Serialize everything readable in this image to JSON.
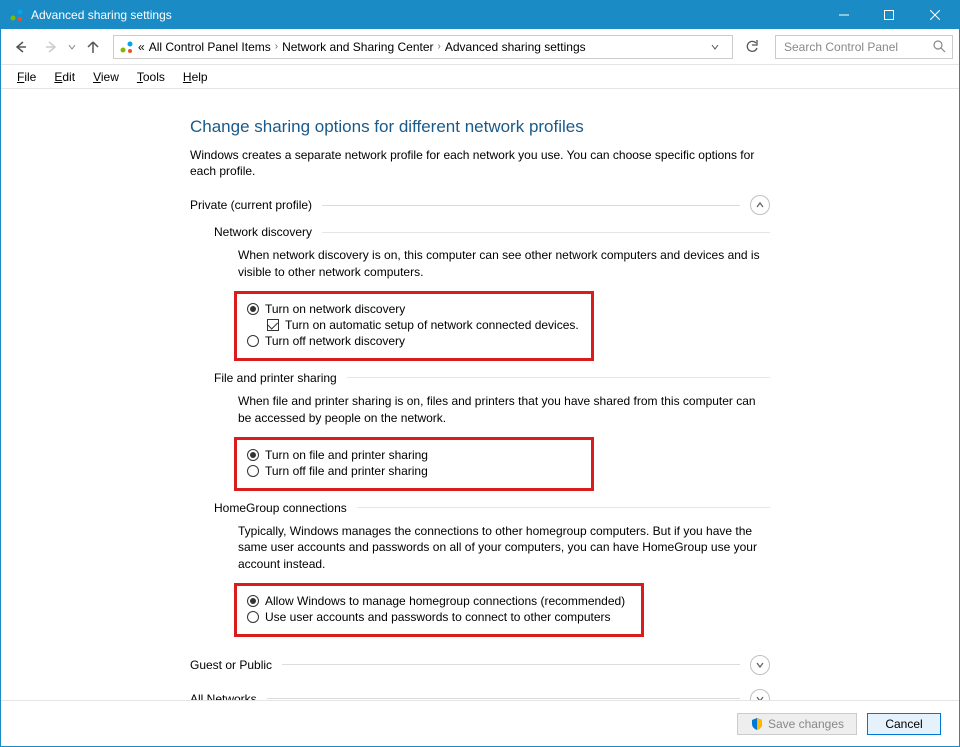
{
  "window": {
    "title": "Advanced sharing settings"
  },
  "breadcrumb": {
    "prefix": "«",
    "items": [
      "All Control Panel Items",
      "Network and Sharing Center",
      "Advanced sharing settings"
    ]
  },
  "search": {
    "placeholder": "Search Control Panel"
  },
  "menu": {
    "file": "File",
    "edit": "Edit",
    "view": "View",
    "tools": "Tools",
    "help": "Help"
  },
  "page": {
    "heading": "Change sharing options for different network profiles",
    "intro": "Windows creates a separate network profile for each network you use. You can choose specific options for each profile."
  },
  "profiles": {
    "private": {
      "label": "Private (current profile)",
      "sections": {
        "network_discovery": {
          "heading": "Network discovery",
          "desc": "When network discovery is on, this computer can see other network computers and devices and is visible to other network computers.",
          "opt_on": "Turn on network discovery",
          "opt_auto": "Turn on automatic setup of network connected devices.",
          "opt_off": "Turn off network discovery"
        },
        "file_printer": {
          "heading": "File and printer sharing",
          "desc": "When file and printer sharing is on, files and printers that you have shared from this computer can be accessed by people on the network.",
          "opt_on": "Turn on file and printer sharing",
          "opt_off": "Turn off file and printer sharing"
        },
        "homegroup": {
          "heading": "HomeGroup connections",
          "desc": "Typically, Windows manages the connections to other homegroup computers. But if you have the same user accounts and passwords on all of your computers, you can have HomeGroup use your account instead.",
          "opt_allow": "Allow Windows to manage homegroup connections (recommended)",
          "opt_user": "Use user accounts and passwords to connect to other computers"
        }
      }
    },
    "guest": {
      "label": "Guest or Public"
    },
    "all": {
      "label": "All Networks"
    }
  },
  "footer": {
    "save": "Save changes",
    "cancel": "Cancel"
  }
}
